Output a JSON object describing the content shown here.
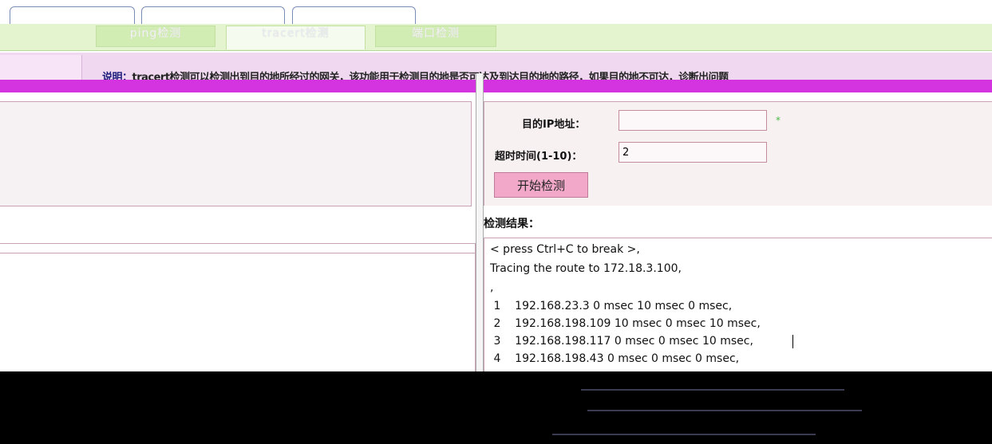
{
  "top_tabs": [
    "",
    "",
    ""
  ],
  "green_tabs": [
    {
      "label": "ping检测",
      "active": false
    },
    {
      "label": "tracert检测",
      "active": true
    },
    {
      "label": "端口检测",
      "active": false
    }
  ],
  "note": {
    "label": "说明：",
    "text": "tracert检测可以检测出到目的地所经过的网关，该功能用于检测目的地是否可达及到达目的地的路径，如果目的地不可达，诊断出问题"
  },
  "form": {
    "dest_ip_label": "目的IP地址：",
    "dest_ip_value": "",
    "required_mark": "*",
    "timeout_label": "超时时间(1-10)：",
    "timeout_value": "2",
    "start_button": "开始检测"
  },
  "result": {
    "label": "检测结果：",
    "lines": [
      "< press Ctrl+C to break >,",
      "Tracing the route to 172.18.3.100,",
      ",",
      " 1    192.168.23.3 0 msec 10 msec 0 msec,",
      " 2    192.168.198.109 10 msec 0 msec 10 msec,",
      " 3    192.168.198.117 0 msec 0 msec 10 msec,",
      " 4    192.168.198.43 0 msec 0 msec 0 msec,"
    ]
  }
}
